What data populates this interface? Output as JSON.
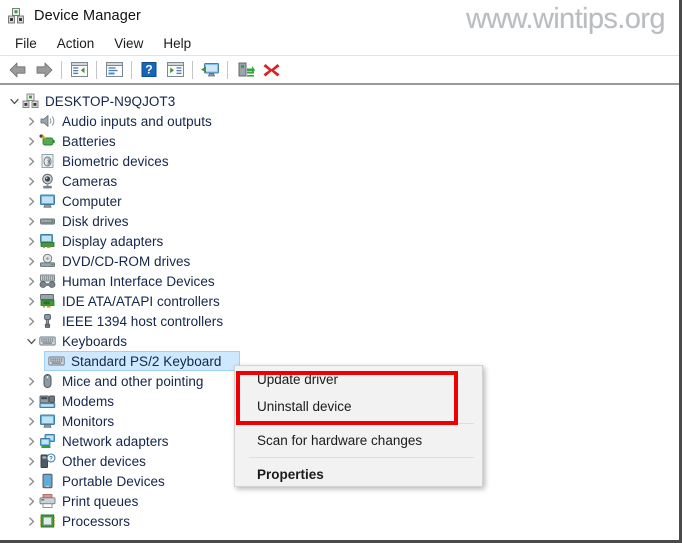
{
  "window": {
    "title": "Device Manager",
    "title_icon": "device-manager-icon"
  },
  "watermark": {
    "text": "www.wintips.org"
  },
  "menubar": {
    "items": [
      {
        "label": "File"
      },
      {
        "label": "Action"
      },
      {
        "label": "View"
      },
      {
        "label": "Help"
      }
    ]
  },
  "toolbar": {
    "buttons": [
      {
        "name": "back-button",
        "icon": "back-arrow-icon",
        "title": "Back"
      },
      {
        "name": "forward-button",
        "icon": "forward-arrow-icon",
        "title": "Forward"
      },
      {
        "name": "show-hide-console-tree-button",
        "icon": "console-tree-icon",
        "title": "Show/Hide Console Tree"
      },
      {
        "name": "properties-button",
        "icon": "properties-window-icon",
        "title": "Properties"
      },
      {
        "name": "help-button",
        "icon": "help-question-icon",
        "title": "Help"
      },
      {
        "name": "show-hide-action-pane-button",
        "icon": "action-pane-icon",
        "title": "Show/Hide Action Pane"
      },
      {
        "name": "scan-for-hardware-changes-button",
        "icon": "scan-monitor-icon",
        "title": "Scan for hardware changes"
      },
      {
        "name": "update-driver-button",
        "icon": "update-driver-icon",
        "title": "Update driver"
      },
      {
        "name": "uninstall-device-button",
        "icon": "red-x-icon",
        "title": "Uninstall device"
      }
    ]
  },
  "tree": {
    "nodes": [
      {
        "label": "DESKTOP-N9QJOT3",
        "level": 0,
        "state": "expanded",
        "icon": "computer-device-icon",
        "selected": false
      },
      {
        "label": "Audio inputs and outputs",
        "level": 1,
        "state": "collapsed",
        "icon": "speaker-icon",
        "selected": false
      },
      {
        "label": "Batteries",
        "level": 1,
        "state": "collapsed",
        "icon": "battery-icon",
        "selected": false
      },
      {
        "label": "Biometric devices",
        "level": 1,
        "state": "collapsed",
        "icon": "fingerprint-icon",
        "selected": false
      },
      {
        "label": "Cameras",
        "level": 1,
        "state": "collapsed",
        "icon": "camera-icon",
        "selected": false
      },
      {
        "label": "Computer",
        "level": 1,
        "state": "collapsed",
        "icon": "monitor-icon",
        "selected": false
      },
      {
        "label": "Disk drives",
        "level": 1,
        "state": "collapsed",
        "icon": "disk-drive-icon",
        "selected": false
      },
      {
        "label": "Display adapters",
        "level": 1,
        "state": "collapsed",
        "icon": "display-adapter-icon",
        "selected": false
      },
      {
        "label": "DVD/CD-ROM drives",
        "level": 1,
        "state": "collapsed",
        "icon": "dvd-drive-icon",
        "selected": false
      },
      {
        "label": "Human Interface Devices",
        "level": 1,
        "state": "collapsed",
        "icon": "hid-gamepad-icon",
        "selected": false
      },
      {
        "label": "IDE ATA/ATAPI controllers",
        "level": 1,
        "state": "collapsed",
        "icon": "ide-controller-icon",
        "selected": false
      },
      {
        "label": "IEEE 1394 host controllers",
        "level": 1,
        "state": "collapsed",
        "icon": "firewire-plug-icon",
        "selected": false
      },
      {
        "label": "Keyboards",
        "level": 1,
        "state": "expanded",
        "icon": "keyboard-icon",
        "selected": false
      },
      {
        "label": "Standard PS/2 Keyboard",
        "level": 2,
        "state": "leaf",
        "icon": "keyboard-icon",
        "selected": true
      },
      {
        "label": "Mice and other pointing",
        "level": 1,
        "state": "collapsed",
        "icon": "mouse-icon",
        "selected": false
      },
      {
        "label": "Modems",
        "level": 1,
        "state": "collapsed",
        "icon": "modem-icon",
        "selected": false
      },
      {
        "label": "Monitors",
        "level": 1,
        "state": "collapsed",
        "icon": "monitor-icon",
        "selected": false
      },
      {
        "label": "Network adapters",
        "level": 1,
        "state": "collapsed",
        "icon": "network-adapter-icon",
        "selected": false
      },
      {
        "label": "Other devices",
        "level": 1,
        "state": "collapsed",
        "icon": "unknown-device-icon",
        "selected": false
      },
      {
        "label": "Portable Devices",
        "level": 1,
        "state": "collapsed",
        "icon": "portable-device-icon",
        "selected": false
      },
      {
        "label": "Print queues",
        "level": 1,
        "state": "collapsed",
        "icon": "printer-icon",
        "selected": false
      },
      {
        "label": "Processors",
        "level": 1,
        "state": "collapsed",
        "icon": "processor-icon",
        "selected": false
      }
    ]
  },
  "context_menu": {
    "items": [
      {
        "label": "Update driver",
        "bold": false,
        "highlighted": true
      },
      {
        "label": "Uninstall device",
        "bold": false,
        "highlighted": true
      },
      {
        "label": "Scan for hardware changes",
        "bold": false,
        "highlighted": false
      },
      {
        "label": "Properties",
        "bold": true,
        "highlighted": false
      }
    ],
    "highlight_color": "#ee0000"
  },
  "colors": {
    "selection": "#cde8ff",
    "text": "#13264a",
    "annotation": "#ee0000",
    "watermark": "#b9bcc0"
  }
}
